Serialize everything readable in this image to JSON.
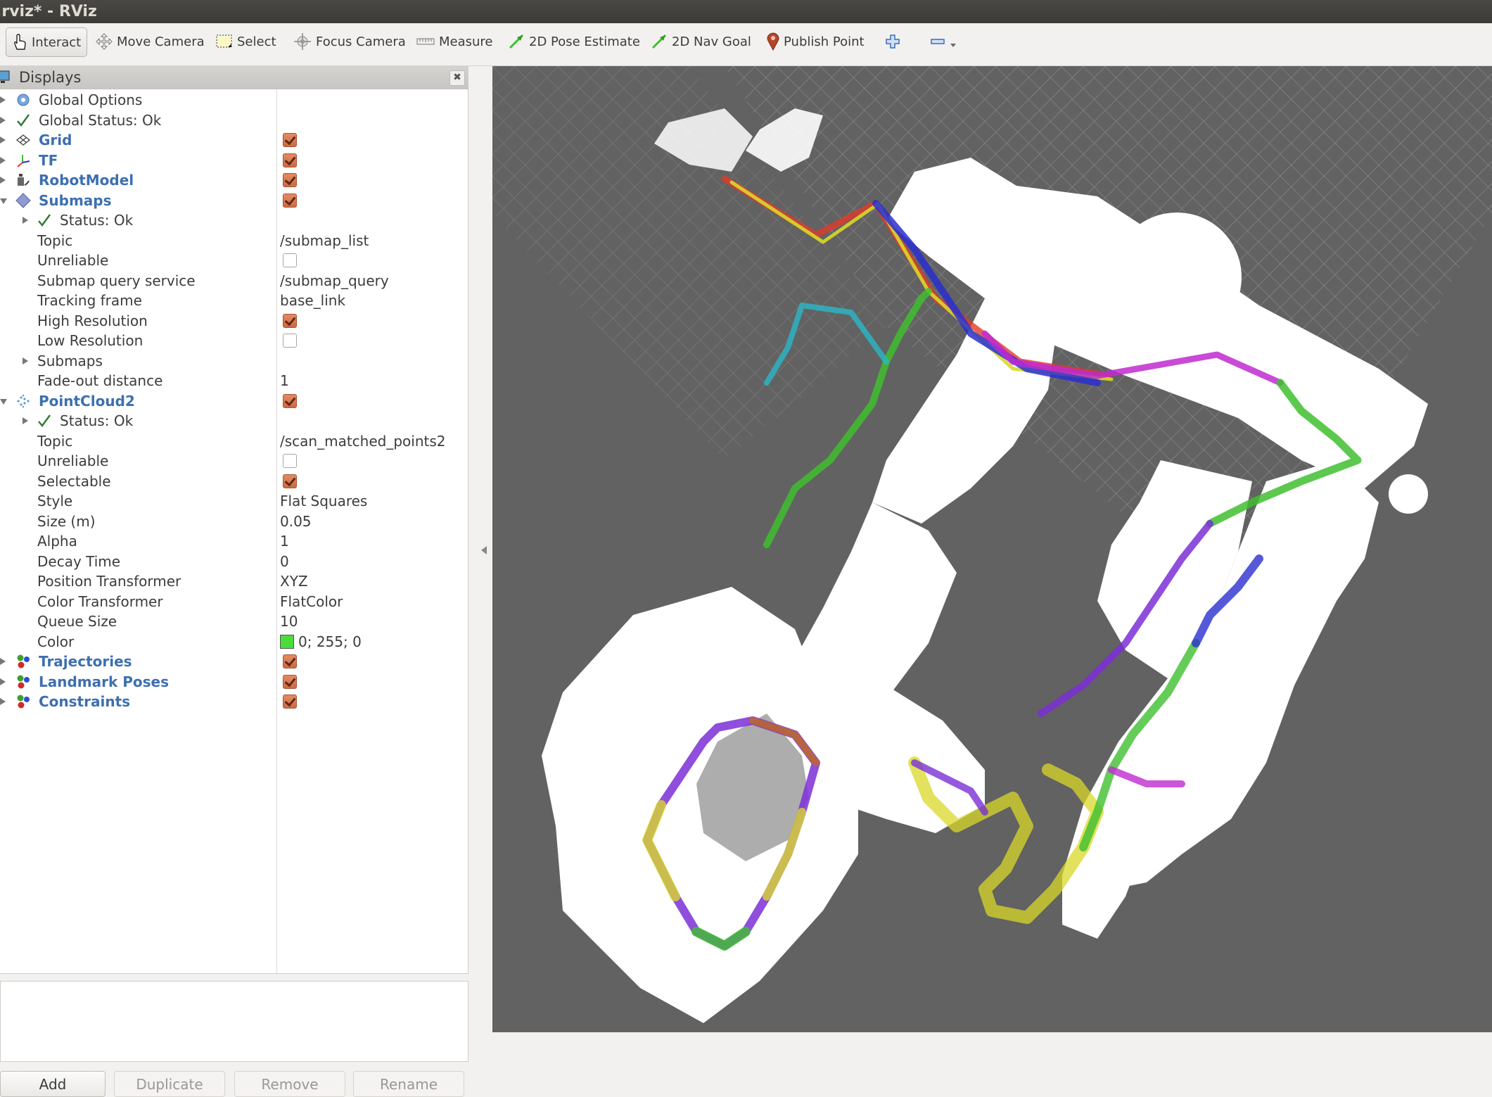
{
  "window": {
    "title": ".rviz* - RViz"
  },
  "toolbar": {
    "tools": [
      {
        "id": "interact",
        "label": "Interact",
        "icon": "hand-pointer-icon",
        "active": true
      },
      {
        "id": "move-camera",
        "label": "Move Camera",
        "icon": "move-arrows-icon",
        "active": false
      },
      {
        "id": "select",
        "label": "Select",
        "icon": "selection-box-icon",
        "active": false
      },
      {
        "id": "focus-camera",
        "label": "Focus Camera",
        "icon": "crosshair-icon",
        "active": false
      },
      {
        "id": "measure",
        "label": "Measure",
        "icon": "ruler-icon",
        "active": false
      },
      {
        "id": "2d-pose-estimate",
        "label": "2D Pose Estimate",
        "icon": "green-arrow-icon",
        "active": false
      },
      {
        "id": "2d-nav-goal",
        "label": "2D Nav Goal",
        "icon": "green-arrow-icon",
        "active": false
      },
      {
        "id": "publish-point",
        "label": "Publish Point",
        "icon": "map-pin-icon",
        "active": false
      }
    ],
    "add_tool_icon": "plus-icon",
    "remove_tool_icon": "minus-icon"
  },
  "displays_panel": {
    "title": "Displays",
    "close_icon": "close-icon",
    "rows": [
      {
        "depth": 0,
        "expander": "right",
        "icon": "gear-icon",
        "name": "Global Options",
        "kind": "plain"
      },
      {
        "depth": 0,
        "expander": "right",
        "icon": "check-icon",
        "name": "Global Status: Ok",
        "kind": "plain"
      },
      {
        "depth": 0,
        "expander": "right",
        "icon": "grid-icon",
        "name": "Grid",
        "kind": "display",
        "checked": true
      },
      {
        "depth": 0,
        "expander": "right",
        "icon": "tf-axes-icon",
        "name": "TF",
        "kind": "display",
        "checked": true
      },
      {
        "depth": 0,
        "expander": "right",
        "icon": "robot-icon",
        "name": "RobotModel",
        "kind": "display",
        "checked": true
      },
      {
        "depth": 0,
        "expander": "down",
        "icon": "diamond-icon",
        "name": "Submaps",
        "kind": "display",
        "checked": true
      },
      {
        "depth": 1,
        "expander": "right",
        "icon": "check-icon",
        "name": "Status: Ok",
        "kind": "plain"
      },
      {
        "depth": 1,
        "name": "Topic",
        "kind": "prop",
        "value": "/submap_list"
      },
      {
        "depth": 1,
        "name": "Unreliable",
        "kind": "prop",
        "checked": false
      },
      {
        "depth": 1,
        "name": "Submap query service",
        "kind": "prop",
        "value": "/submap_query"
      },
      {
        "depth": 1,
        "name": "Tracking frame",
        "kind": "prop",
        "value": "base_link"
      },
      {
        "depth": 1,
        "name": "High Resolution",
        "kind": "prop",
        "checked": true
      },
      {
        "depth": 1,
        "name": "Low Resolution",
        "kind": "prop",
        "checked": false
      },
      {
        "depth": 1,
        "expander": "right",
        "name": "Submaps",
        "kind": "prop"
      },
      {
        "depth": 1,
        "name": "Fade-out distance",
        "kind": "prop",
        "value": "1"
      },
      {
        "depth": 0,
        "expander": "down",
        "icon": "pointcloud-icon",
        "name": "PointCloud2",
        "kind": "display",
        "checked": true
      },
      {
        "depth": 1,
        "expander": "right",
        "icon": "check-icon",
        "name": "Status: Ok",
        "kind": "plain"
      },
      {
        "depth": 1,
        "name": "Topic",
        "kind": "prop",
        "value": "/scan_matched_points2"
      },
      {
        "depth": 1,
        "name": "Unreliable",
        "kind": "prop",
        "checked": false
      },
      {
        "depth": 1,
        "name": "Selectable",
        "kind": "prop",
        "checked": true
      },
      {
        "depth": 1,
        "name": "Style",
        "kind": "prop",
        "value": "Flat Squares"
      },
      {
        "depth": 1,
        "name": "Size (m)",
        "kind": "prop",
        "value": "0.05"
      },
      {
        "depth": 1,
        "name": "Alpha",
        "kind": "prop",
        "value": "1"
      },
      {
        "depth": 1,
        "name": "Decay Time",
        "kind": "prop",
        "value": "0"
      },
      {
        "depth": 1,
        "name": "Position Transformer",
        "kind": "prop",
        "value": "XYZ"
      },
      {
        "depth": 1,
        "name": "Color Transformer",
        "kind": "prop",
        "value": "FlatColor"
      },
      {
        "depth": 1,
        "name": "Queue Size",
        "kind": "prop",
        "value": "10"
      },
      {
        "depth": 1,
        "name": "Color",
        "kind": "prop",
        "value": "0; 255; 0",
        "swatch": "#4cdc3a"
      },
      {
        "depth": 0,
        "expander": "right",
        "icon": "marker-spheres-icon",
        "name": "Trajectories",
        "kind": "display",
        "checked": true
      },
      {
        "depth": 0,
        "expander": "right",
        "icon": "marker-spheres-icon",
        "name": "Landmark Poses",
        "kind": "display",
        "checked": true
      },
      {
        "depth": 0,
        "expander": "right",
        "icon": "marker-spheres-icon",
        "name": "Constraints",
        "kind": "display",
        "checked": true
      }
    ],
    "buttons": [
      {
        "label": "Add",
        "enabled": true
      },
      {
        "label": "Duplicate",
        "enabled": false
      },
      {
        "label": "Remove",
        "enabled": false
      },
      {
        "label": "Rename",
        "enabled": false
      }
    ]
  },
  "colors": {
    "display_name": "#3d6fb0",
    "checkbox_on": "#d9764f",
    "view_background": "#626262",
    "status_ok": "#2e7d32"
  },
  "view3d": {
    "name": "3D render view",
    "trajectory_colors": [
      "#7b2fd6",
      "#2a2fd0",
      "#3fbf2f",
      "#d8d82a",
      "#e23a2a",
      "#2ab8c8",
      "#c06a1a",
      "#c02ad0"
    ]
  }
}
